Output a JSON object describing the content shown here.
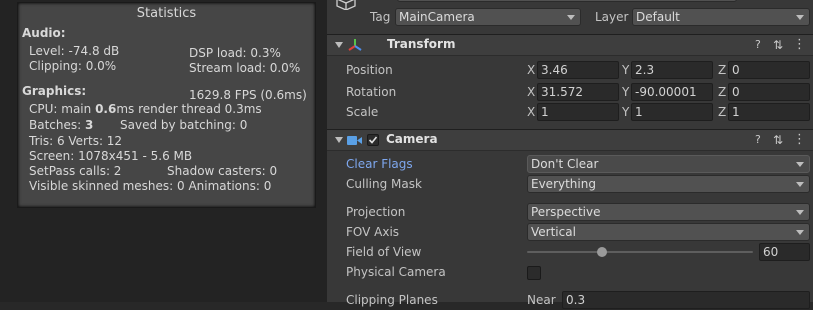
{
  "statistics": {
    "title": "Statistics",
    "audio_header": "Audio:",
    "level": "Level: -74.8 dB",
    "dsp_load": "DSP load: 0.3%",
    "clipping": "Clipping: 0.0%",
    "stream_load": "Stream load: 0.0%",
    "graphics_header": "Graphics:",
    "fps": "1629.8 FPS (0.6ms)",
    "cpu_prefix": "CPU: main ",
    "cpu_main": "0.6",
    "cpu_suffix": "ms  render thread 0.3ms",
    "batches_prefix": "Batches: ",
    "batches": "3",
    "saved_by_batching": "Saved by batching: 0",
    "tris_verts": "Tris: 6  Verts: 12",
    "screen": "Screen: 1078x451 - 5.6 MB",
    "setpass": "SetPass calls: 2",
    "shadow_casters": "Shadow casters: 0",
    "visible_skinned": "Visible skinned meshes: 0  Animations: 0"
  },
  "object_header": {
    "tag_label": "Tag",
    "tag_value": "MainCamera",
    "layer_label": "Layer",
    "layer_value": "Default"
  },
  "transform": {
    "title": "Transform",
    "position": {
      "label": "Position",
      "x": "3.46",
      "y": "2.3",
      "z": "0"
    },
    "rotation": {
      "label": "Rotation",
      "x": "31.572",
      "y": "-90.00001",
      "z": "0"
    },
    "scale": {
      "label": "Scale",
      "x": "1",
      "y": "1",
      "z": "1"
    },
    "axis_x": "X",
    "axis_y": "Y",
    "axis_z": "Z"
  },
  "camera": {
    "title": "Camera",
    "enabled": true,
    "clear_flags": {
      "label": "Clear Flags",
      "value": "Don't Clear"
    },
    "culling_mask": {
      "label": "Culling Mask",
      "value": "Everything"
    },
    "projection": {
      "label": "Projection",
      "value": "Perspective"
    },
    "fov_axis": {
      "label": "FOV Axis",
      "value": "Vertical"
    },
    "field_of_view": {
      "label": "Field of View",
      "value": "60",
      "slider_fraction": 0.33
    },
    "physical_camera": {
      "label": "Physical Camera",
      "checked": false
    },
    "clipping_planes": {
      "label": "Clipping Planes",
      "near_label": "Near",
      "near_value": "0.3"
    }
  },
  "icons": [
    "gameobject-icon",
    "transform-icon",
    "camera-icon",
    "help-icon",
    "preset-icon",
    "menu-icon"
  ],
  "colors": {
    "selected_label": "#7ea7ee",
    "transform_axes": [
      "#e0403a",
      "#57c24c",
      "#4d8ef0"
    ],
    "camera_icon": "#5aa0e6"
  }
}
